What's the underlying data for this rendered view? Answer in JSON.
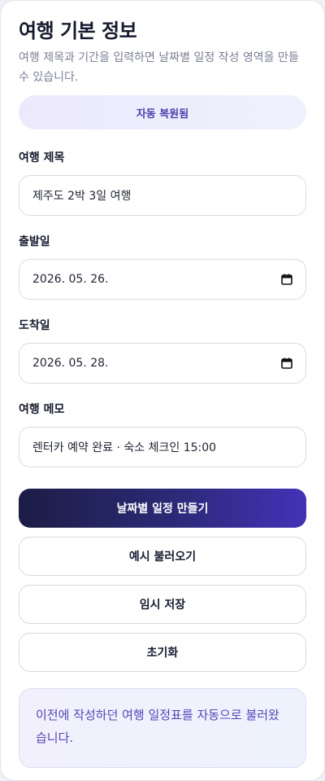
{
  "header": {
    "title": "여행 기본 정보",
    "subtitle": "여행 제목과 기간을 입력하면 날짜별 일정 작성 영역을 만들 수 있습니다."
  },
  "status": {
    "restore_label": "자동 복원됨"
  },
  "form": {
    "trip_title": {
      "label": "여행 제목",
      "value": "제주도 2박 3일 여행"
    },
    "start_date": {
      "label": "출발일",
      "value": "2026. 05. 26."
    },
    "end_date": {
      "label": "도착일",
      "value": "2026. 05. 28."
    },
    "memo": {
      "label": "여행 메모",
      "value": "렌터카 예약 완료 · 숙소 체크인 15:00"
    }
  },
  "actions": {
    "generate": "날짜별 일정 만들기",
    "load_example": "예시 불러오기",
    "save_draft": "임시 저장",
    "reset": "초기화"
  },
  "notice": {
    "text": "이전에 작성하던 여행 일정표를 자동으로 불러왔습니다."
  },
  "icons": {
    "date_picker": "calendar-icon"
  },
  "colors": {
    "accent": "#4a3fb0",
    "primary_gradient_start": "#1c1d45",
    "primary_gradient_end": "#4332b8",
    "notice_text": "#5247b7"
  }
}
